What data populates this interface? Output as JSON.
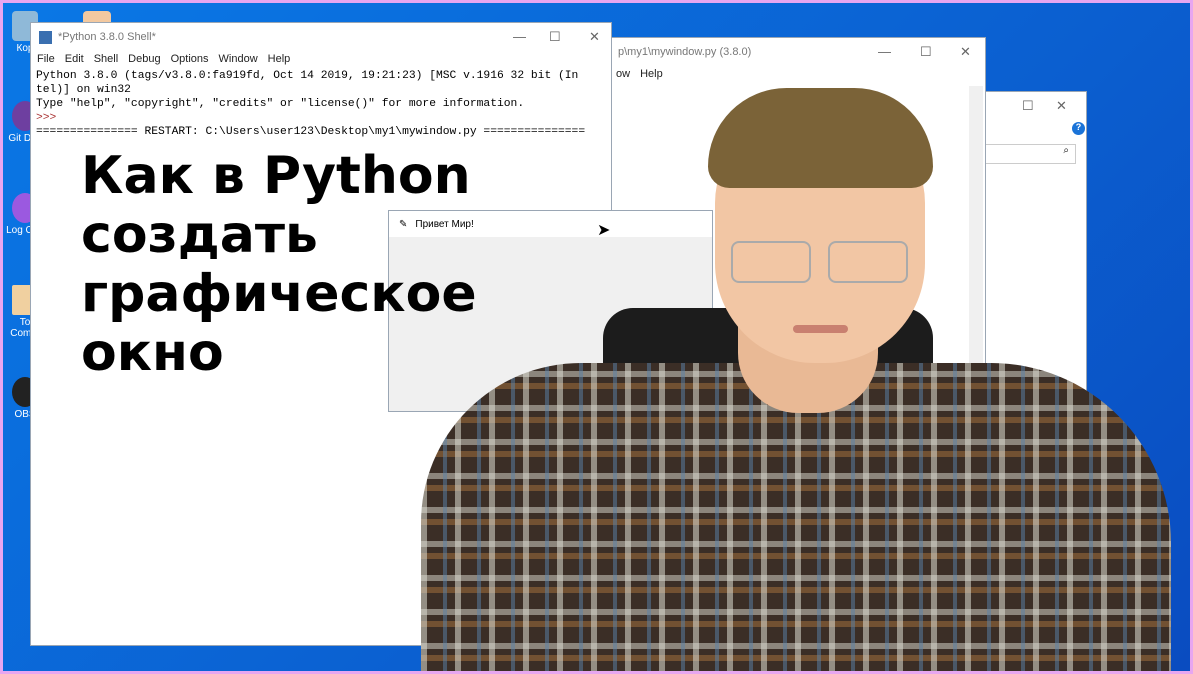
{
  "desktop": {
    "icons": [
      {
        "label": "Кор"
      },
      {
        "label": "Git Des"
      },
      {
        "label": "Log Cap"
      },
      {
        "label": "To Comm"
      },
      {
        "label": "OBS"
      }
    ]
  },
  "shell": {
    "title": "*Python 3.8.0 Shell*",
    "menu": [
      "File",
      "Edit",
      "Shell",
      "Debug",
      "Options",
      "Window",
      "Help"
    ],
    "lines": [
      "Python 3.8.0 (tags/v3.8.0:fa919fd, Oct 14 2019, 19:21:23) [MSC v.1916 32 bit (In",
      "tel)] on win32",
      "Type \"help\", \"copyright\", \"credits\" or \"license()\" for more information."
    ],
    "prompt": ">>>",
    "restart": "=============== RESTART: C:\\Users\\user123\\Desktop\\my1\\mywindow.py ==============="
  },
  "editor": {
    "title": "p\\my1\\mywindow.py (3.8.0)",
    "menu": [
      "ow",
      "Help"
    ]
  },
  "tk": {
    "title": "Привет Мир!"
  },
  "overlay": {
    "line1": "Как в Python",
    "line2": "создать",
    "line3": "графическое",
    "line4": "окно"
  },
  "colors": {
    "desktop": "#0b5fd0",
    "frame": "#e7a6f0"
  }
}
